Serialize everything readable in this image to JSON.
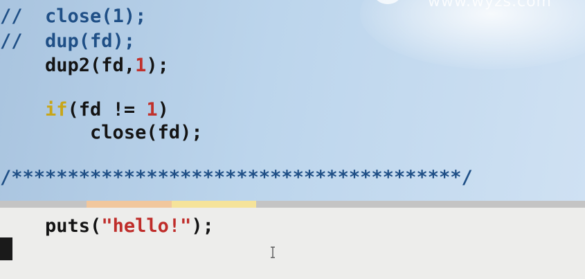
{
  "watermark": "www.wyzs.com",
  "code": {
    "line1": {
      "comment": "//",
      "text": "close(1);"
    },
    "line2": {
      "comment": "//",
      "text": "dup(fd);"
    },
    "line3": {
      "prefix": "dup2(fd,",
      "num": "1",
      "suffix": ");"
    },
    "line4": {
      "kw": "if",
      "prefix": "(fd != ",
      "num": "1",
      "suffix": ")"
    },
    "line5": {
      "text": "close(fd);"
    },
    "separator": "/****************************************/",
    "line6": {
      "prefix": "puts(",
      "str": "\"hello!\"",
      "suffix": ");"
    }
  },
  "colors": {
    "code_blue": "#1f4f86",
    "keyword": "#c8a618",
    "number": "#c0312c",
    "string": "#bf2d2a"
  }
}
